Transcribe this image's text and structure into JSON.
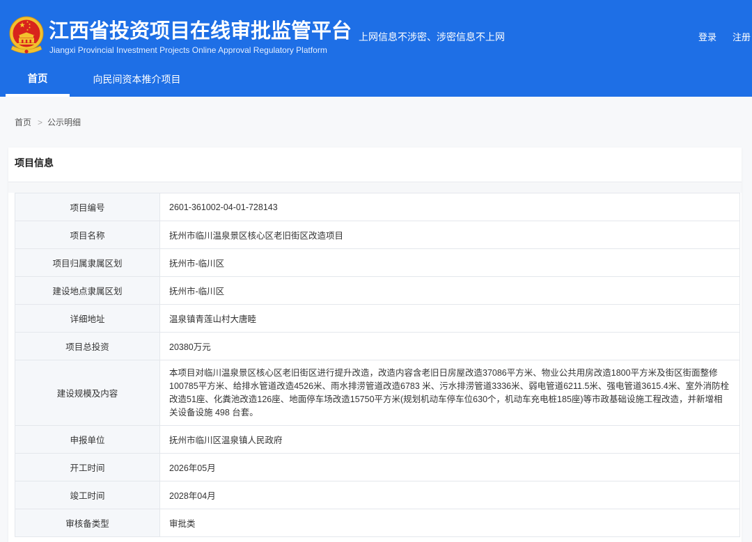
{
  "header": {
    "emblem_icon": "national-emblem-icon",
    "title": "江西省投资项目在线审批监管平台",
    "subtitle": "Jiangxi Provincial Investment Projects Online Approval Regulatory Platform",
    "slogan": "上网信息不涉密、涉密信息不上网",
    "login_label": "登录",
    "register_label": "注册"
  },
  "nav": {
    "items": [
      {
        "label": "首页",
        "active": true
      },
      {
        "label": "向民间资本推介项目",
        "active": false
      }
    ]
  },
  "breadcrumb": {
    "home": "首页",
    "separator": ">",
    "current": "公示明细"
  },
  "project_info": {
    "title": "项目信息",
    "rows": [
      {
        "label": "项目编号",
        "value": "2601-361002-04-01-728143"
      },
      {
        "label": "项目名称",
        "value": "抚州市临川温泉景区核心区老旧街区改造项目"
      },
      {
        "label": "项目归属隶属区划",
        "value": "抚州市-临川区"
      },
      {
        "label": "建设地点隶属区划",
        "value": "抚州市-临川区"
      },
      {
        "label": "详细地址",
        "value": "温泉镇青莲山村大唐睦"
      },
      {
        "label": "项目总投资",
        "value": "20380万元"
      },
      {
        "label": "建设规模及内容",
        "value": "本项目对临川温泉景区核心区老旧街区进行提升改造，改造内容含老旧日房屋改造37086平方米、物业公共用房改造1800平方米及街区街面整修100785平方米、给排水管道改造4526米、雨水排涝管道改造6783 米、污水排涝管道3336米、弱电管道6211.5米、强电管道3615.4米、室外消防栓改造51座、化粪池改造126座、地面停车场改造15750平方米(规划机动车停车位630个，机动车充电桩185座)等市政基础设施工程改造，并新增相关设备设施 498 台套。"
      },
      {
        "label": "申报单位",
        "value": "抚州市临川区温泉镇人民政府"
      },
      {
        "label": "开工时间",
        "value": "2026年05月"
      },
      {
        "label": "竣工时间",
        "value": "2028年04月"
      },
      {
        "label": "审核备类型",
        "value": "审批类"
      }
    ]
  },
  "colors": {
    "header_blue": "#1e6fe6",
    "label_background": "#f5f7fa",
    "border": "#e4e7ec",
    "text": "#333333",
    "emblem_red": "#d8241c",
    "emblem_gold": "#f2c12e"
  }
}
